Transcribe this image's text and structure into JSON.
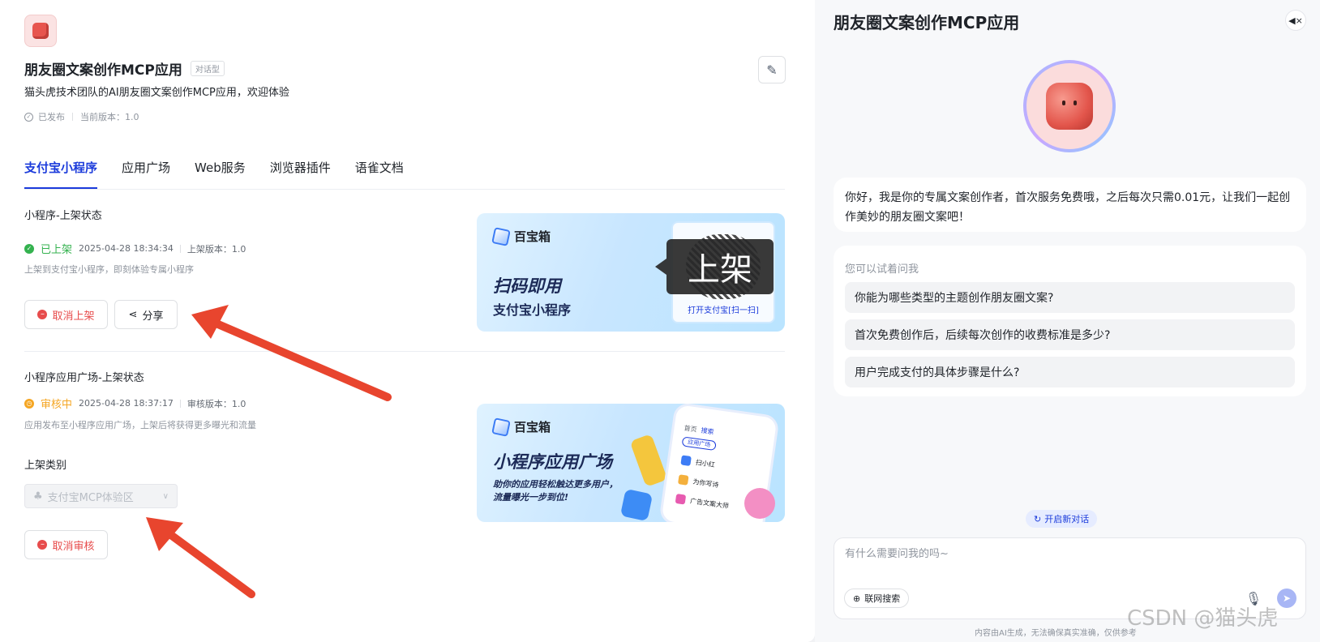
{
  "app": {
    "title": "朋友圈文案创作MCP应用",
    "type_tag": "对话型",
    "description": "猫头虎技术团队的AI朋友圈文案创作MCP应用，欢迎体验",
    "status": "已发布",
    "version": "当前版本：1.0",
    "edit_icon": "✎"
  },
  "tabs": [
    "支付宝小程序",
    "应用广场",
    "Web服务",
    "浏览器插件",
    "语雀文档"
  ],
  "miniprogram": {
    "title": "小程序-上架状态",
    "status": "已上架",
    "time": "2025-04-28 18:34:34",
    "version": "上架版本：1.0",
    "hint": "上架到支付宝小程序，即刻体验专属小程序",
    "cancel_label": "取消上架",
    "share_label": "分享",
    "share_icon": "⋖"
  },
  "plaza": {
    "title": "小程序应用广场-上架状态",
    "status": "审核中",
    "time": "2025-04-28 18:37:17",
    "version": "审核版本：1.0",
    "hint": "应用发布至小程序应用广场，上架后将获得更多曝光和流量",
    "category_label": "上架类别",
    "category_value": "支付宝MCP体验区",
    "cancel_label": "取消审核"
  },
  "banner1": {
    "brand": "百宝箱",
    "headline": "扫码即用",
    "sub": "支付宝小程序",
    "qr_caption": "打开支付宝[扫一扫]",
    "overlay": "上架"
  },
  "banner2": {
    "brand": "百宝箱",
    "headline": "小程序应用广场",
    "sub_line1": "助你的应用轻松触达更多用户，",
    "sub_line2": "流量曝光一步到位!",
    "phone_tab_home": "首页",
    "phone_tab_search": "搜索",
    "phone_chip1": "应用广场",
    "phone_rows": [
      "扫小红",
      "为你写诗",
      "广告文案大师"
    ]
  },
  "chat": {
    "title": "朋友圈文案创作MCP应用",
    "mute_icon": "◀×",
    "greeting": "你好，我是你的专属文案创作者，首次服务免费哦，之后每次只需0.01元，让我们一起创作美妙的朋友圈文案吧！",
    "suggest_title": "您可以试着问我",
    "suggestions": [
      "你能为哪些类型的主题创作朋友圈文案?",
      "首次免费创作后，后续每次创作的收费标准是多少?",
      "用户完成支付的具体步骤是什么?"
    ],
    "new_chat": "开启新对话",
    "new_chat_icon": "↻",
    "input_placeholder": "有什么需要问我的吗~",
    "web_search": "联网搜索",
    "web_search_icon": "⊕",
    "mic_icon": "🎙",
    "send_icon": "➤",
    "disclaimer": "内容由AI生成，无法确保真实准确，仅供参考"
  },
  "watermark": "CSDN @猫头虎",
  "colors": {
    "accent": "#1b3bdb",
    "danger": "#e74c4c",
    "success": "#34b24f",
    "warning": "#f5a623",
    "arrow": "#e8452e"
  }
}
